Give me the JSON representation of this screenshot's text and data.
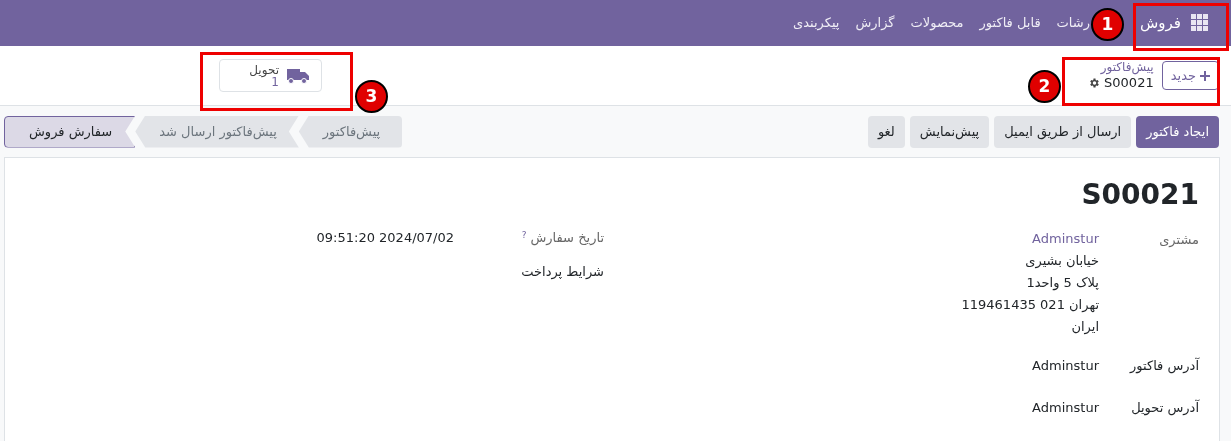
{
  "navbar": {
    "app_name": "فروش",
    "menu": [
      "رشات",
      "قابل فاکتور",
      "محصولات",
      "گزارش",
      "پیکربندی"
    ]
  },
  "control_panel": {
    "new_button": "جدید",
    "breadcrumb": "پیش‌فاکتور",
    "record": "S00021",
    "smart_button": {
      "label": "تحویل",
      "count": "1"
    }
  },
  "actions": [
    {
      "label": "ایجاد فاکتور",
      "primary": true
    },
    {
      "label": "ارسال از طریق ایمیل",
      "primary": false
    },
    {
      "label": "پیش‌نمایش",
      "primary": false
    },
    {
      "label": "لغو",
      "primary": false
    }
  ],
  "stages": [
    {
      "label": "پیش‌فاکتور",
      "selected": false
    },
    {
      "label": "پیش‌فاکتور ارسال شد",
      "selected": false
    },
    {
      "label": "سفارش فروش",
      "selected": true
    }
  ],
  "form": {
    "title": "S00021",
    "customer": {
      "label": "مشتری",
      "name": "Adminstur",
      "address": [
        "خیابان بشیری",
        "پلاک 5 واحد1",
        "تهران 021 119461435",
        "ایران"
      ]
    },
    "invoice_address": {
      "label": "آدرس فاکتور",
      "value": "Adminstur"
    },
    "delivery_address": {
      "label": "آدرس تحویل",
      "value": "Adminstur"
    },
    "order_date": {
      "label": "تاریخ سفارش",
      "help": "?",
      "value": "2024/07/02 09:51:20"
    },
    "payment_terms": {
      "label": "شرایط پرداخت"
    }
  },
  "annotations": [
    "1",
    "2",
    "3"
  ]
}
